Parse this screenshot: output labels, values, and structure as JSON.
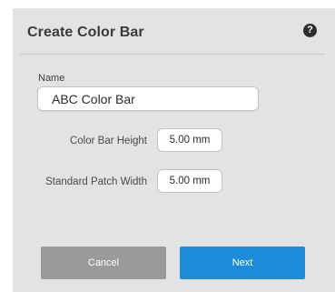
{
  "dialog": {
    "title": "Create Color Bar",
    "help_icon": "?"
  },
  "form": {
    "name_label": "Name",
    "name_value": "ABC Color Bar",
    "color_bar_height_label": "Color Bar Height",
    "color_bar_height_value": "5.00 mm",
    "standard_patch_width_label": "Standard Patch Width",
    "standard_patch_width_value": "5.00 mm"
  },
  "buttons": {
    "cancel_label": "Cancel",
    "next_label": "Next"
  },
  "colors": {
    "dialog_background": "#e3e3e3",
    "cancel_button": "#9a9a9a",
    "next_button": "#1a8cd8"
  }
}
